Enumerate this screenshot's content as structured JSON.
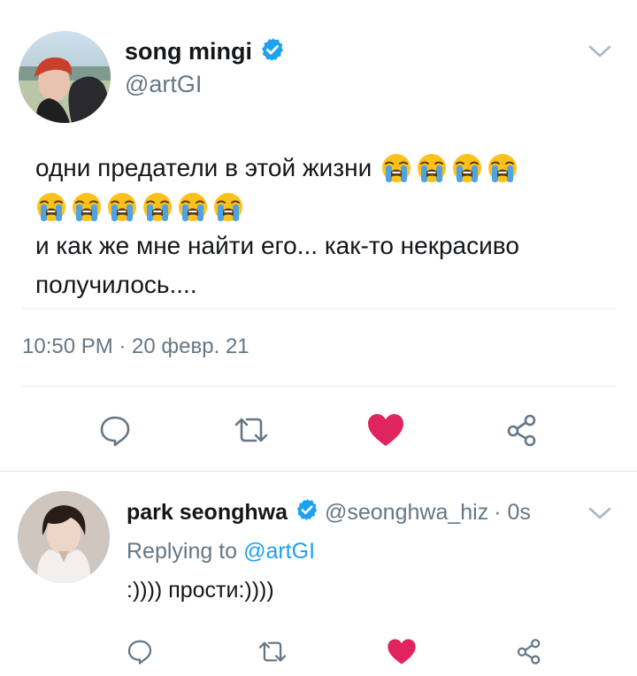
{
  "tweet": {
    "author_name": "song mingi",
    "author_handle": "@artGI",
    "text_line1": "одни предатели в этой жизни",
    "text_line2": "и как же мне найти его... как-то некрасиво",
    "text_line3": "получилось....",
    "emoji": "loudly-crying-face",
    "emoji_count_line1": 4,
    "emoji_count_line2": 6,
    "timestamp": "10:50 PM · 20 февр. 21",
    "liked": true,
    "verified": true
  },
  "reply": {
    "author_name": "park seonghwa",
    "author_handle": "@seonghwa_hiz",
    "time": "· 0s",
    "replying_prefix": "Replying to",
    "replying_handle": "@artGI",
    "text": ":)))) прости:))))",
    "liked": true,
    "verified": true
  },
  "icons": {
    "reply": "reply-icon",
    "retweet": "retweet-icon",
    "like": "heart-icon",
    "share": "share-icon",
    "more": "chevron-down-icon",
    "verified": "verified-badge-icon"
  },
  "colors": {
    "accent": "#1da1f2",
    "like": "#e0245e",
    "muted": "#657786",
    "divider": "#e6ecf0",
    "text": "#14171a"
  }
}
